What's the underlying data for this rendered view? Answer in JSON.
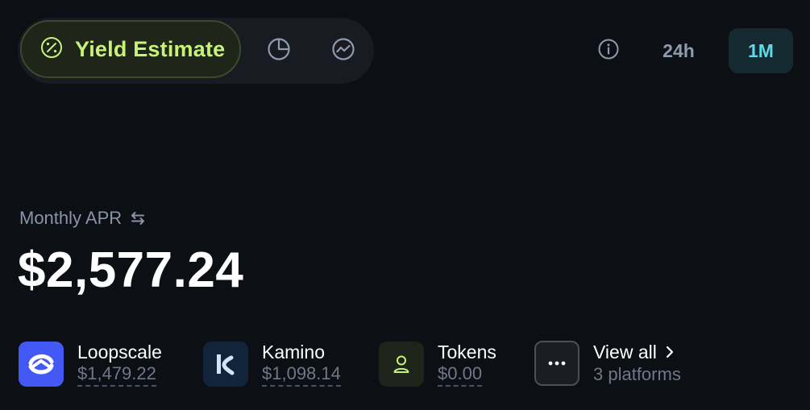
{
  "tabs": {
    "active_label": "Yield Estimate",
    "icons": [
      "percent-icon",
      "pie-chart-icon",
      "line-chart-icon"
    ]
  },
  "time_ranges": [
    {
      "label": "24h",
      "selected": false
    },
    {
      "label": "1M",
      "selected": true
    }
  ],
  "summary": {
    "label": "Monthly APR",
    "value": "$2,577.24"
  },
  "platforms": [
    {
      "name": "Loopscale",
      "value": "$1,479.22"
    },
    {
      "name": "Kamino",
      "value": "$1,098.14",
      "logo_text": "k"
    },
    {
      "name": "Tokens",
      "value": "$0.00"
    }
  ],
  "view_all": {
    "label": "View all",
    "sublabel": "3 platforms"
  },
  "colors": {
    "background": "#0c0f14",
    "accent_green": "#c7f27a",
    "accent_cyan": "#5fd9ea",
    "loopscale_brand": "#4458f5",
    "kamino_brand": "#12243a"
  }
}
